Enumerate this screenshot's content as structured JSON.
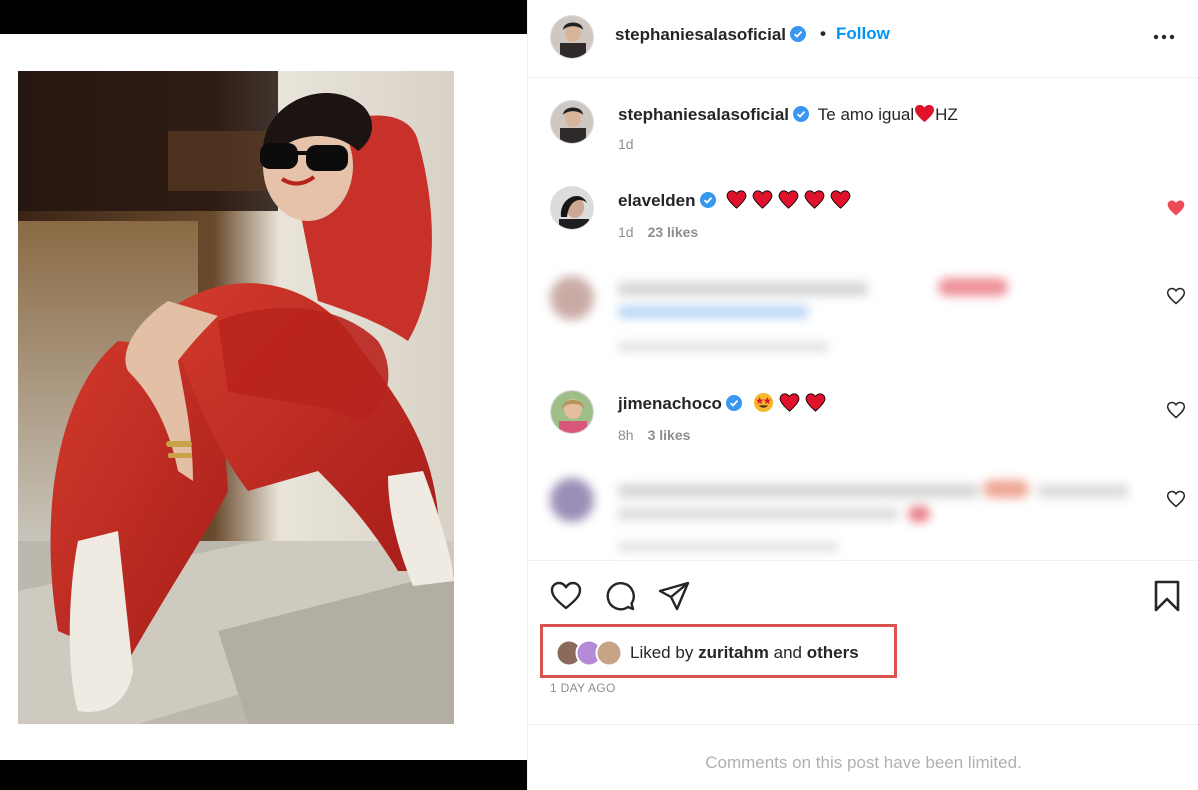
{
  "post": {
    "author": "stephaniesalasoficial",
    "follow_label": "Follow",
    "separator": "•"
  },
  "caption": {
    "username": "stephaniesalasoficial",
    "text_before": "Te amo igual",
    "text_after": "HZ",
    "time": "1d"
  },
  "comments": [
    {
      "username": "elavelden",
      "hearts": 5,
      "time": "1d",
      "likes": "23 likes",
      "liked": true
    },
    {
      "username": "jimenachoco",
      "emojis": [
        "star-struck",
        "heart",
        "heart"
      ],
      "time": "8h",
      "likes": "3 likes",
      "liked": false
    }
  ],
  "likes": {
    "prefix": "Liked by",
    "user": "zuritahm",
    "conj": "and",
    "others": "others"
  },
  "timestamp": "1 DAY AGO",
  "comments_limited": "Comments on this post have been limited.",
  "colors": {
    "accent": "#0095f6",
    "like_red": "#ed4956",
    "highlight_box": "#d9534f",
    "dress_red": "#c62a22"
  },
  "icons": [
    "verified-badge-icon",
    "more-options-icon",
    "heart-icon",
    "comment-icon",
    "share-icon",
    "bookmark-icon"
  ]
}
